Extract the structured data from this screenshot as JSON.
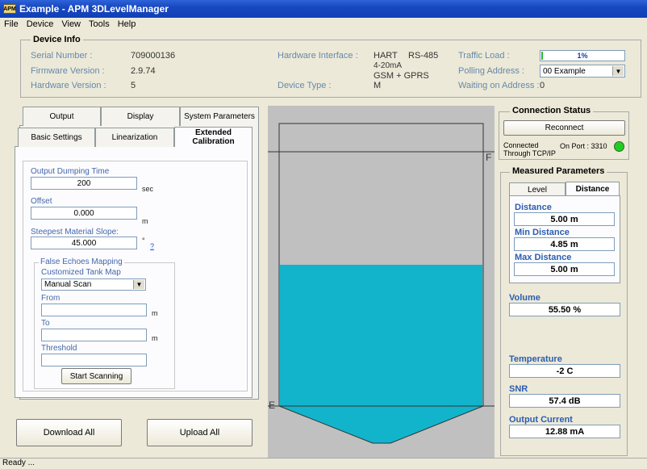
{
  "window": {
    "title": "Example - APM 3DLevelManager",
    "icon_text": "APM"
  },
  "menu": [
    "File",
    "Device",
    "View",
    "Tools",
    "Help"
  ],
  "device_info": {
    "title": "Device Info",
    "serial_label": "Serial Number :",
    "serial": "709000136",
    "firmware_label": "Firmware Version :",
    "firmware": "2.9.74",
    "hardware_label": "Hardware Version :",
    "hardware": "5",
    "hw_interface_label": "Hardware Interface :",
    "hw_interface_1": "HART",
    "hw_interface_2": "RS-485",
    "hw_interface_3": "4-20mA",
    "hw_interface_4": "GSM + GPRS",
    "device_type_label": "Device Type :",
    "device_type": "M",
    "traffic_label": "Traffic Load :",
    "traffic_text": "1%",
    "traffic_value": 1,
    "polling_label": "Polling Address :",
    "polling": "00 Example",
    "waiting_label": "Waiting on Address :",
    "waiting": "0"
  },
  "tabs_row1": [
    "Output",
    "Display",
    "System Parameters"
  ],
  "tabs_row2": [
    "Basic Settings",
    "Linearization",
    "Extended Calibration"
  ],
  "calibration": {
    "dumping_label": "Output Dumping Time",
    "dumping": "200",
    "dumping_unit": "sec",
    "offset_label": "Offset",
    "offset": "0.000",
    "offset_unit": "m",
    "slope_label": "Steepest Material Slope:",
    "slope": "45.000",
    "slope_unit": "°",
    "help": "?",
    "false_echo_title": "False Echoes Mapping",
    "tank_map_label": "Customized Tank Map",
    "tank_map": "Manual Scan",
    "from_label": "From",
    "from": "",
    "from_unit": "m",
    "to_label": "To",
    "to": "",
    "to_unit": "m",
    "threshold_label": "Threshold",
    "threshold": "",
    "scan_button": "Start Scanning"
  },
  "buttons": {
    "download": "Download All",
    "upload": "Upload All"
  },
  "tank": {
    "fill_fraction": 0.5,
    "top_marker": "F",
    "bottom_marker": "E",
    "fill_color": "#12b4cc"
  },
  "connection": {
    "title": "Connection Status",
    "reconnect": "Reconnect",
    "status_1": "Connected",
    "status_2": "Through TCP/IP",
    "port": "On Port : 3310",
    "led_color": "#22cc22"
  },
  "measured": {
    "title": "Measured Parameters",
    "tab_level": "Level",
    "tab_distance": "Distance",
    "distance_label": "Distance",
    "distance": "5.00 m",
    "min_label": "Min Distance",
    "min": "4.85 m",
    "max_label": "Max Distance",
    "max": "5.00 m",
    "volume_label": "Volume",
    "volume": "55.50 %",
    "temperature_label": "Temperature",
    "temperature": "-2 C",
    "snr_label": "SNR",
    "snr": "57.4 dB",
    "current_label": "Output Current",
    "current": "12.88 mA"
  },
  "status": "Ready ..."
}
